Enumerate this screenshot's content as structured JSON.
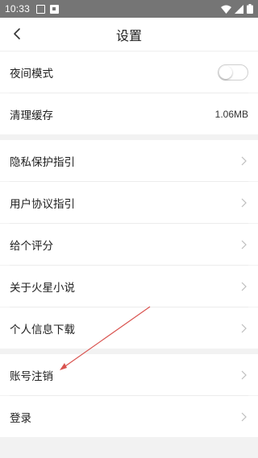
{
  "status_bar": {
    "time": "10:33"
  },
  "header": {
    "title": "设置"
  },
  "section1": {
    "night_mode_label": "夜间模式",
    "night_mode_on": false,
    "clear_cache_label": "清理缓存",
    "cache_size": "1.06MB"
  },
  "section2": {
    "items": [
      {
        "label": "隐私保护指引"
      },
      {
        "label": "用户协议指引"
      },
      {
        "label": "给个评分"
      },
      {
        "label": "关于火星小说"
      },
      {
        "label": "个人信息下载"
      }
    ]
  },
  "section3": {
    "items": [
      {
        "label": "账号注销"
      },
      {
        "label": "登录"
      }
    ]
  },
  "colors": {
    "statusbar": "#757575",
    "annotation_arrow": "#d9534f"
  }
}
